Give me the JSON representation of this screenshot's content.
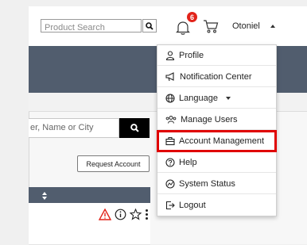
{
  "header": {
    "search_placeholder": "Product Search",
    "notification_count": "6",
    "username": "Otoniel"
  },
  "user_menu": {
    "items": [
      {
        "label": "Profile",
        "icon": "person-icon"
      },
      {
        "label": "Notification Center",
        "icon": "megaphone-icon"
      },
      {
        "label": "Language",
        "icon": "globe-icon"
      },
      {
        "label": "Manage Users",
        "icon": "users-icon"
      },
      {
        "label": "Account Management",
        "icon": "briefcase-icon",
        "highlighted": true
      },
      {
        "label": "Help",
        "icon": "question-icon"
      },
      {
        "label": "System Status",
        "icon": "status-icon"
      },
      {
        "label": "Logout",
        "icon": "logout-icon"
      }
    ]
  },
  "filters": {
    "search_placeholder": "er, Name or City"
  },
  "actions": {
    "request_account_label": "Request Account"
  },
  "colors": {
    "banner": "#515d6e",
    "highlight": "#e00000",
    "badge": "#e2231a"
  }
}
